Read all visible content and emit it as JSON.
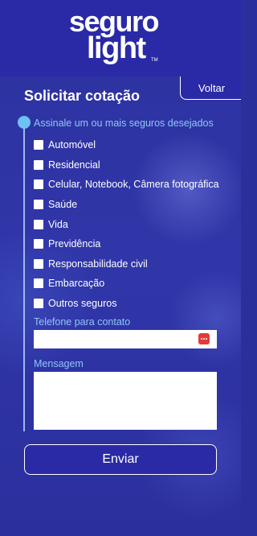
{
  "brand": {
    "line1": "seguro",
    "line2": "light",
    "tm": "TM"
  },
  "header": {
    "title": "Solicitar cotação",
    "back_label": "Voltar"
  },
  "form": {
    "insurance_prompt": "Assinale um ou mais seguros desejados",
    "options": [
      {
        "label": "Automóvel",
        "checked": false
      },
      {
        "label": "Residencial",
        "checked": false
      },
      {
        "label": "Celular, Notebook, Câmera fotográfica",
        "checked": false
      },
      {
        "label": "Saúde",
        "checked": false
      },
      {
        "label": "Vida",
        "checked": false
      },
      {
        "label": "Previdência",
        "checked": false
      },
      {
        "label": "Responsabilidade civil",
        "checked": false
      },
      {
        "label": "Embarcação",
        "checked": false
      },
      {
        "label": "Outros seguros",
        "checked": false
      }
    ],
    "phone_label": "Telefone para contato",
    "phone_value": "",
    "message_label": "Mensagem",
    "message_value": "",
    "submit_label": "Enviar"
  },
  "colors": {
    "header_bg": "#2a2aa6",
    "accent_label": "#8fc6f5",
    "timeline_dot": "#6ec1f5",
    "autofill_icon": "#e53935"
  }
}
